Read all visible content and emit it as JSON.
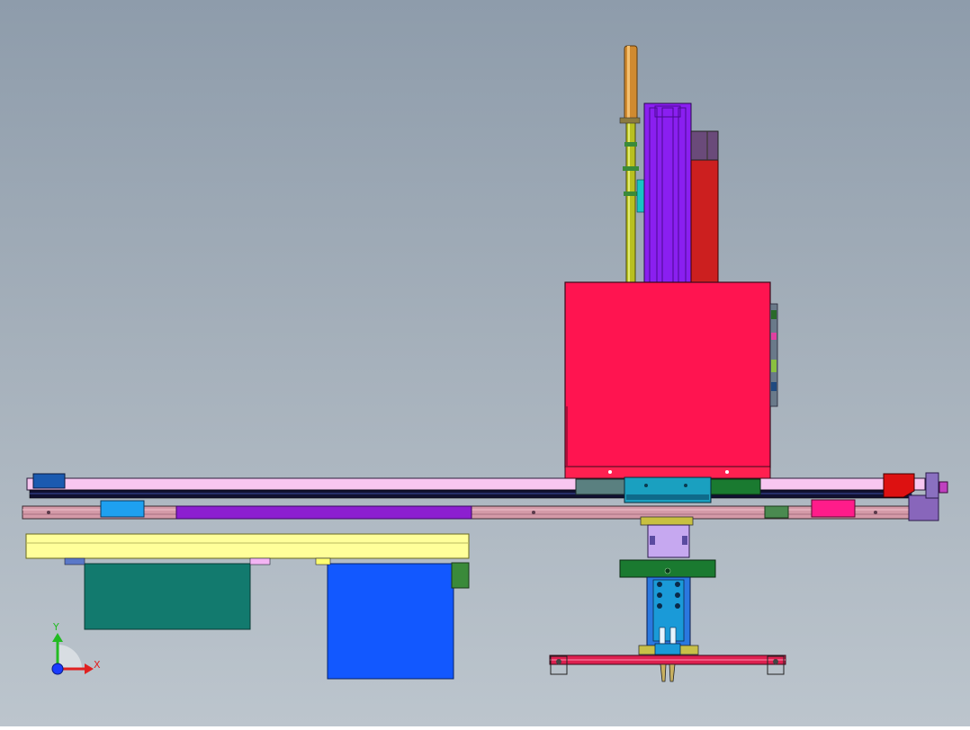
{
  "viewport": {
    "background_top": "#8e9cab",
    "background_bottom": "#bcc5cd"
  },
  "triad": {
    "y_label": "Y",
    "x_label": "X",
    "y_color": "#22bb22",
    "x_color": "#e02020",
    "origin_color": "#1a3cff"
  },
  "colors": {
    "crimson_housing": "#ff1450",
    "purple_column": "#8a1ff0",
    "red_column": "#cc1f1f",
    "rod_gold": "#d08a30",
    "rod_yellow": "#b8c020",
    "beam_pink": "#f8c6f0",
    "rail_pink": "#d49aa8",
    "rail_purple": "#8c1fd0",
    "tray_yellow": "#ffff9a",
    "box_teal": "#127a6e",
    "box_blue": "#1258ff",
    "plate_green": "#1a7a30",
    "carriage_teal": "#1aa0c0",
    "gripper_blue": "#2a78e0",
    "cap_red": "#dd1111",
    "end_bracket": "#8866bb"
  }
}
